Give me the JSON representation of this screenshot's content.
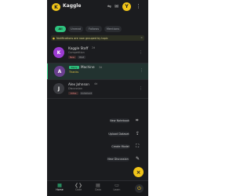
{
  "app": {
    "title": "Kaggle",
    "logo_letter": "K",
    "account_initial": "Y"
  },
  "topbar": {
    "icons": [
      "translate-icon",
      "mail-icon",
      "menu-icon"
    ]
  },
  "chips": [
    {
      "label": "All",
      "active": true
    },
    {
      "label": "Unread",
      "active": false
    },
    {
      "label": "Follows",
      "active": false
    },
    {
      "label": "Mentions",
      "active": false
    }
  ],
  "notice": {
    "text": "Notifications are now grouped by topic"
  },
  "cards": [
    {
      "avatar_letter": "K",
      "avatar_color": "#9b3bd1",
      "name": "Kaggle Staff",
      "meta": "2d",
      "sub": "Competition",
      "tags": [
        "New",
        "Post"
      ]
    },
    {
      "avatar_letter": "A",
      "avatar_color": "#6a3f8f",
      "name": "Machine",
      "meta": "3d",
      "tag": "Reply",
      "note": "Thanks"
    },
    {
      "avatar_letter": "J",
      "avatar_color": "#3a3b40",
      "name": "Alex Johnson",
      "meta": "4d",
      "sub": "Discussion",
      "tags": [
        "Votes",
        "Comment"
      ]
    }
  ],
  "fab_menu": [
    {
      "label": "New Notebook",
      "icon": "notebook-icon"
    },
    {
      "label": "Upload Dataset",
      "icon": "upload-icon"
    },
    {
      "label": "Create Model",
      "icon": "model-icon"
    },
    {
      "label": "New Discussion",
      "icon": "discussion-icon"
    }
  ],
  "fab": {
    "symbol": "×"
  },
  "bottom_nav": [
    {
      "label": "Home",
      "icon": "home-icon",
      "active": true
    },
    {
      "label": "Code",
      "icon": "code-icon",
      "active": false
    },
    {
      "label": "Data",
      "icon": "data-icon",
      "active": false
    },
    {
      "label": "Learn",
      "icon": "learn-icon",
      "active": false
    }
  ],
  "colors": {
    "accent": "#2ec27e",
    "brand": "#f0c419",
    "background": "#1b1c1f"
  }
}
